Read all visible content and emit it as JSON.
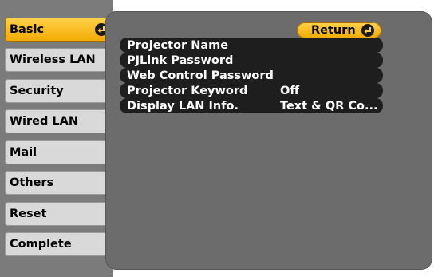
{
  "sidebar": {
    "items": [
      {
        "label": "Basic",
        "active": true
      },
      {
        "label": "Wireless LAN"
      },
      {
        "label": "Security"
      },
      {
        "label": "Wired LAN"
      },
      {
        "label": "Mail"
      },
      {
        "label": "Others"
      },
      {
        "label": "Reset"
      },
      {
        "label": "Complete"
      }
    ]
  },
  "main": {
    "return_label": "Return",
    "menu": [
      {
        "label": "Projector Name",
        "value": ""
      },
      {
        "label": "PJLink Password",
        "value": ""
      },
      {
        "label": "Web Control Password",
        "value": ""
      },
      {
        "label": "Projector Keyword",
        "value": "Off"
      },
      {
        "label": "Display LAN Info.",
        "value": "Text & QR Co..."
      }
    ]
  },
  "colors": {
    "accent": "#f3a900",
    "panel": "#6c6c6c",
    "row": "#1e1e1e"
  },
  "icons": {
    "enter": "enter-icon"
  }
}
